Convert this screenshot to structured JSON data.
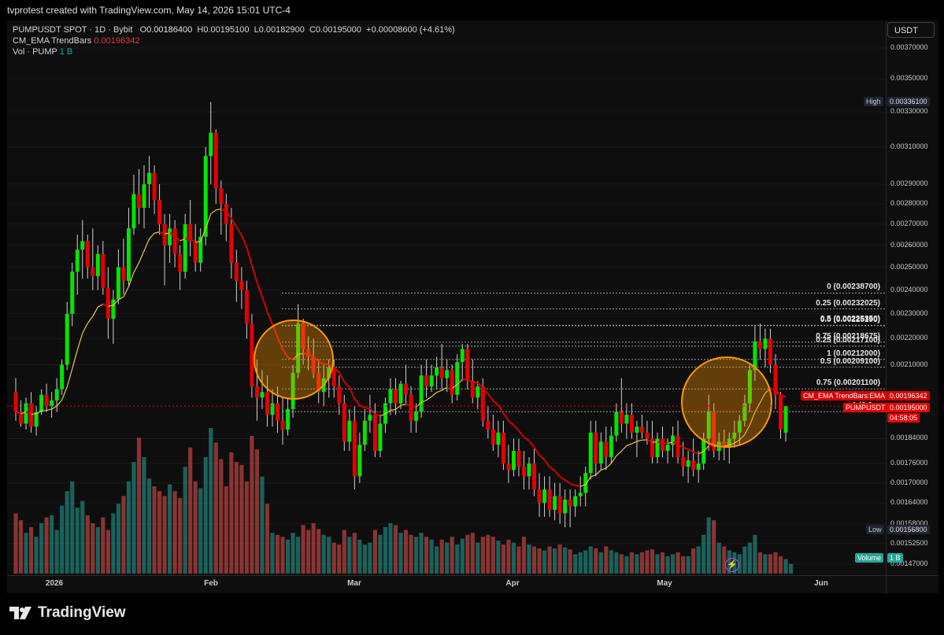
{
  "header": {
    "title": "tvprotest created with TradingView.com, May 14, 2026 15:01 UTC-4"
  },
  "legend": {
    "symbol": "PUMPUSDT SPOT · 1D · Bybit",
    "ohlc": {
      "o_label": "O",
      "o": "0.00186400",
      "h_label": "H",
      "h": "0.00195100",
      "l_label": "L",
      "l": "0.00182900",
      "c_label": "C",
      "c": "0.00195000",
      "change": "+0.00008600 (+4.61%)"
    },
    "indicator_name": "CM_EMA TrendBars",
    "indicator_value": "0.00196342",
    "volume_name": "Vol · PUMP",
    "volume_value": "1 B"
  },
  "currency_button": "USDT",
  "y_axis_ticks": [
    "0.00370000",
    "0.00350000",
    "0.00330000",
    "0.00310000",
    "0.00290000",
    "0.00280000",
    "0.00270000",
    "0.00260000",
    "0.00250000",
    "0.00240000",
    "0.00230000",
    "0.00220000",
    "0.00210000",
    "0.00184000",
    "0.00176000",
    "0.00170000",
    "0.00164000",
    "0.00158000",
    "0.00152500",
    "0.00147000"
  ],
  "x_axis_ticks": [
    "2026",
    "Feb",
    "Mar",
    "Apr",
    "May",
    "Jun"
  ],
  "price_tags": {
    "high_label": "High",
    "high": "0.00336100",
    "ema_label": "CM_EMA TrendBars:EMA",
    "ema": "0.00196342",
    "last_label": "PUMPUSDT",
    "last": "0.00195000",
    "countdown": "04:58:05",
    "low_label": "Low",
    "low": "0.00156800",
    "volume_label": "Volume",
    "volume": "1 B"
  },
  "fib_levels": [
    {
      "label": "0 (0.00238700)",
      "price": 0.002387
    },
    {
      "label": "0.25 (0.00232025)",
      "price": 0.00232025
    },
    {
      "label": "0.5 (0.00225350)",
      "price": 0.0022535
    },
    {
      "label": "0.0 (0.00225190)",
      "price": 0.0022519
    },
    {
      "label": "0.75 (0.00218675)",
      "price": 0.00218675
    },
    {
      "label": "0.25 (0.00217100)",
      "price": 0.002171
    },
    {
      "label": "1 (0.00212000)",
      "price": 0.00212
    },
    {
      "label": "0.5 (0.00209100)",
      "price": 0.002091
    },
    {
      "label": "0.75 (0.00201100)",
      "price": 0.002011
    },
    {
      "label": "1 (0.0…",
      "price": 0.001931
    }
  ],
  "colors": {
    "up": "#00e600",
    "down": "#e60000",
    "ema": "#d50000",
    "ema_up": "#e6c84a",
    "vol_up": "#26a69a",
    "vol_down": "#ef5350",
    "circle": "#ff9800",
    "background": "#0e0e0e"
  },
  "brand": "TradingView",
  "chart_data": {
    "type": "candlestick",
    "title": "PUMPUSDT SPOT · 1D · Bybit",
    "ylim": [
      0.00147,
      0.0038
    ],
    "y_scale": "log",
    "x_start": "2025-12-23",
    "x_end": "2026-06-08",
    "candles": [
      [
        0.002,
        0.00205,
        0.0019,
        0.00193
      ],
      [
        0.00193,
        0.00197,
        0.00188,
        0.00189
      ],
      [
        0.00189,
        0.00198,
        0.00187,
        0.00196
      ],
      [
        0.00196,
        0.002,
        0.00186,
        0.00188
      ],
      [
        0.00188,
        0.00195,
        0.00185,
        0.00193
      ],
      [
        0.00193,
        0.00201,
        0.00192,
        0.00199
      ],
      [
        0.00199,
        0.00203,
        0.00193,
        0.00195
      ],
      [
        0.00195,
        0.002,
        0.00191,
        0.00197
      ],
      [
        0.00197,
        0.00205,
        0.00193,
        0.00201
      ],
      [
        0.00201,
        0.00212,
        0.00199,
        0.0021
      ],
      [
        0.0021,
        0.00235,
        0.00208,
        0.0023
      ],
      [
        0.0023,
        0.00252,
        0.00225,
        0.00248
      ],
      [
        0.00248,
        0.00265,
        0.00238,
        0.00258
      ],
      [
        0.00258,
        0.00272,
        0.00245,
        0.00262
      ],
      [
        0.00262,
        0.00265,
        0.00245,
        0.0025
      ],
      [
        0.0025,
        0.00268,
        0.0024,
        0.00246
      ],
      [
        0.00246,
        0.0026,
        0.0024,
        0.00256
      ],
      [
        0.00256,
        0.00262,
        0.00238,
        0.00241
      ],
      [
        0.00241,
        0.0025,
        0.0022,
        0.00228
      ],
      [
        0.00228,
        0.0024,
        0.00218,
        0.00236
      ],
      [
        0.00236,
        0.00258,
        0.00234,
        0.0025
      ],
      [
        0.0025,
        0.00263,
        0.00238,
        0.00244
      ],
      [
        0.00244,
        0.00278,
        0.00242,
        0.00268
      ],
      [
        0.00268,
        0.00295,
        0.00265,
        0.00285
      ],
      [
        0.00285,
        0.00298,
        0.0027,
        0.00278
      ],
      [
        0.00278,
        0.003,
        0.00268,
        0.0029
      ],
      [
        0.0029,
        0.00305,
        0.00278,
        0.00296
      ],
      [
        0.00296,
        0.003,
        0.00275,
        0.00282
      ],
      [
        0.00282,
        0.0029,
        0.00265,
        0.0027
      ],
      [
        0.0027,
        0.00275,
        0.00242,
        0.0026
      ],
      [
        0.0026,
        0.00275,
        0.00252,
        0.00268
      ],
      [
        0.00268,
        0.00272,
        0.0025,
        0.00256
      ],
      [
        0.00256,
        0.0026,
        0.0024,
        0.00248
      ],
      [
        0.00248,
        0.00275,
        0.00245,
        0.0027
      ],
      [
        0.0027,
        0.00282,
        0.00255,
        0.00262
      ],
      [
        0.00262,
        0.0027,
        0.00248,
        0.00252
      ],
      [
        0.00252,
        0.00268,
        0.00248,
        0.00264
      ],
      [
        0.00264,
        0.0031,
        0.0026,
        0.00305
      ],
      [
        0.00305,
        0.00336,
        0.0029,
        0.00318
      ],
      [
        0.00318,
        0.0032,
        0.0028,
        0.00288
      ],
      [
        0.00288,
        0.00292,
        0.00265,
        0.0028
      ],
      [
        0.0028,
        0.00285,
        0.00262,
        0.0027
      ],
      [
        0.0027,
        0.00278,
        0.00245,
        0.00252
      ],
      [
        0.00252,
        0.00258,
        0.00235,
        0.00244
      ],
      [
        0.00244,
        0.0025,
        0.00232,
        0.0024
      ],
      [
        0.0024,
        0.00244,
        0.0022,
        0.00226
      ],
      [
        0.00226,
        0.0023,
        0.00198,
        0.00202
      ],
      [
        0.00202,
        0.00212,
        0.0019,
        0.00198
      ],
      [
        0.00198,
        0.00208,
        0.00194,
        0.002
      ],
      [
        0.002,
        0.00206,
        0.00188,
        0.00192
      ],
      [
        0.00192,
        0.00201,
        0.00188,
        0.00196
      ],
      [
        0.00196,
        0.00202,
        0.00186,
        0.0019
      ],
      [
        0.0019,
        0.00198,
        0.00182,
        0.00187
      ],
      [
        0.00187,
        0.00198,
        0.00185,
        0.00194
      ],
      [
        0.00194,
        0.0021,
        0.00191,
        0.00207
      ],
      [
        0.00207,
        0.00234,
        0.00205,
        0.00226
      ],
      [
        0.00226,
        0.00228,
        0.0021,
        0.00216
      ],
      [
        0.00216,
        0.00221,
        0.00208,
        0.00213
      ],
      [
        0.00213,
        0.0022,
        0.00205,
        0.00207
      ],
      [
        0.00207,
        0.00212,
        0.00196,
        0.002
      ],
      [
        0.002,
        0.0021,
        0.00195,
        0.00205
      ],
      [
        0.00205,
        0.00212,
        0.00198,
        0.00209
      ],
      [
        0.00209,
        0.00212,
        0.00198,
        0.00202
      ],
      [
        0.00202,
        0.00206,
        0.00192,
        0.00196
      ],
      [
        0.00196,
        0.00199,
        0.0018,
        0.00183
      ],
      [
        0.00183,
        0.00194,
        0.0018,
        0.0019
      ],
      [
        0.0019,
        0.00195,
        0.00168,
        0.00172
      ],
      [
        0.00172,
        0.00186,
        0.0017,
        0.00182
      ],
      [
        0.00182,
        0.00194,
        0.0018,
        0.0019
      ],
      [
        0.0019,
        0.00199,
        0.00186,
        0.00192
      ],
      [
        0.00192,
        0.00196,
        0.00178,
        0.0018
      ],
      [
        0.0018,
        0.00192,
        0.00178,
        0.00189
      ],
      [
        0.00189,
        0.00198,
        0.00186,
        0.00196
      ],
      [
        0.00196,
        0.00205,
        0.00192,
        0.00201
      ],
      [
        0.00201,
        0.00205,
        0.00192,
        0.00196
      ],
      [
        0.00196,
        0.00204,
        0.00194,
        0.00203
      ],
      [
        0.00203,
        0.0021,
        0.00196,
        0.00199
      ],
      [
        0.00199,
        0.00202,
        0.00186,
        0.0019
      ],
      [
        0.0019,
        0.00196,
        0.00186,
        0.00193
      ],
      [
        0.00193,
        0.0021,
        0.00191,
        0.00206
      ],
      [
        0.00206,
        0.00212,
        0.00198,
        0.00202
      ],
      [
        0.00202,
        0.0021,
        0.002,
        0.00206
      ],
      [
        0.00206,
        0.00213,
        0.00201,
        0.00209
      ],
      [
        0.00209,
        0.00218,
        0.00201,
        0.00205
      ],
      [
        0.00205,
        0.00212,
        0.002,
        0.00208
      ],
      [
        0.00208,
        0.0021,
        0.00196,
        0.00199
      ],
      [
        0.00199,
        0.00214,
        0.00197,
        0.00211
      ],
      [
        0.00211,
        0.00218,
        0.00204,
        0.00216
      ],
      [
        0.00216,
        0.00218,
        0.00201,
        0.00204
      ],
      [
        0.00204,
        0.00212,
        0.00196,
        0.00198
      ],
      [
        0.00198,
        0.00204,
        0.00194,
        0.00202
      ],
      [
        0.00202,
        0.00205,
        0.00188,
        0.0019
      ],
      [
        0.0019,
        0.00195,
        0.00184,
        0.00187
      ],
      [
        0.00187,
        0.00192,
        0.0018,
        0.00182
      ],
      [
        0.00182,
        0.0019,
        0.00178,
        0.00186
      ],
      [
        0.00186,
        0.0019,
        0.00174,
        0.00176
      ],
      [
        0.00176,
        0.00182,
        0.0017,
        0.00174
      ],
      [
        0.00174,
        0.00184,
        0.00172,
        0.0018
      ],
      [
        0.0018,
        0.00184,
        0.00172,
        0.00175
      ],
      [
        0.00175,
        0.0018,
        0.00168,
        0.00172
      ],
      [
        0.00172,
        0.00178,
        0.00168,
        0.00176
      ],
      [
        0.00176,
        0.00181,
        0.00166,
        0.00168
      ],
      [
        0.00168,
        0.00173,
        0.0016,
        0.00164
      ],
      [
        0.00164,
        0.00172,
        0.0016,
        0.00168
      ],
      [
        0.00168,
        0.00172,
        0.0016,
        0.00162
      ],
      [
        0.00162,
        0.0017,
        0.00159,
        0.00166
      ],
      [
        0.00166,
        0.0017,
        0.00158,
        0.00161
      ],
      [
        0.00161,
        0.00168,
        0.00157,
        0.00165
      ],
      [
        0.00165,
        0.00168,
        0.00157,
        0.00163
      ],
      [
        0.00163,
        0.00168,
        0.0016,
        0.00166
      ],
      [
        0.00166,
        0.00172,
        0.00163,
        0.00167
      ],
      [
        0.00167,
        0.00175,
        0.00163,
        0.00173
      ],
      [
        0.00173,
        0.0019,
        0.00171,
        0.00186
      ],
      [
        0.00186,
        0.0019,
        0.00172,
        0.00176
      ],
      [
        0.00176,
        0.00186,
        0.00174,
        0.00183
      ],
      [
        0.00183,
        0.00188,
        0.00174,
        0.00178
      ],
      [
        0.00178,
        0.00188,
        0.00176,
        0.00185
      ],
      [
        0.00185,
        0.00196,
        0.00183,
        0.00193
      ],
      [
        0.00193,
        0.00205,
        0.00186,
        0.00189
      ],
      [
        0.00189,
        0.00196,
        0.00184,
        0.00192
      ],
      [
        0.00192,
        0.00196,
        0.00184,
        0.00186
      ],
      [
        0.00186,
        0.0019,
        0.00178,
        0.00188
      ],
      [
        0.00188,
        0.00192,
        0.00184,
        0.00186
      ],
      [
        0.00186,
        0.0019,
        0.00182,
        0.00184
      ],
      [
        0.00184,
        0.0019,
        0.00176,
        0.00178
      ],
      [
        0.00178,
        0.00186,
        0.00176,
        0.00184
      ],
      [
        0.00184,
        0.00188,
        0.00178,
        0.0018
      ],
      [
        0.0018,
        0.00184,
        0.00176,
        0.00182
      ],
      [
        0.00182,
        0.00188,
        0.00178,
        0.00185
      ],
      [
        0.00185,
        0.0019,
        0.00176,
        0.00178
      ],
      [
        0.00178,
        0.00183,
        0.00172,
        0.00175
      ],
      [
        0.00175,
        0.0018,
        0.0017,
        0.00177
      ],
      [
        0.00177,
        0.00184,
        0.00172,
        0.00174
      ],
      [
        0.00174,
        0.0018,
        0.0017,
        0.00176
      ],
      [
        0.00176,
        0.00186,
        0.00174,
        0.00184
      ],
      [
        0.00184,
        0.00199,
        0.0018,
        0.00193
      ],
      [
        0.00193,
        0.00196,
        0.00178,
        0.0018
      ],
      [
        0.0018,
        0.00186,
        0.00177,
        0.00183
      ],
      [
        0.00183,
        0.00187,
        0.00177,
        0.00181
      ],
      [
        0.00181,
        0.00186,
        0.00176,
        0.00184
      ],
      [
        0.00184,
        0.0019,
        0.00181,
        0.00186
      ],
      [
        0.00186,
        0.00192,
        0.00182,
        0.0019
      ],
      [
        0.0019,
        0.00199,
        0.00188,
        0.00196
      ],
      [
        0.00196,
        0.0021,
        0.00193,
        0.00208
      ],
      [
        0.00208,
        0.00225,
        0.00204,
        0.00219
      ],
      [
        0.00219,
        0.00226,
        0.00212,
        0.00216
      ],
      [
        0.00216,
        0.00224,
        0.00209,
        0.0022
      ],
      [
        0.0022,
        0.00224,
        0.00207,
        0.0021
      ],
      [
        0.0021,
        0.00214,
        0.00194,
        0.00199
      ],
      [
        0.00199,
        0.002,
        0.00184,
        0.00187
      ],
      [
        0.00186,
        0.00195,
        0.00183,
        0.00195
      ]
    ],
    "volume": [
      62,
      55,
      42,
      48,
      38,
      52,
      58,
      60,
      45,
      70,
      85,
      95,
      68,
      75,
      60,
      52,
      48,
      58,
      45,
      62,
      72,
      80,
      95,
      115,
      140,
      120,
      98,
      90,
      85,
      80,
      92,
      85,
      78,
      110,
      130,
      95,
      88,
      120,
      150,
      135,
      118,
      90,
      125,
      115,
      112,
      95,
      142,
      128,
      100,
      72,
      42,
      40,
      38,
      35,
      42,
      38,
      50,
      45,
      52,
      46,
      40,
      38,
      32,
      30,
      45,
      38,
      42,
      35,
      30,
      32,
      45,
      40,
      48,
      52,
      50,
      42,
      45,
      40,
      38,
      42,
      38,
      35,
      28,
      35,
      32,
      38,
      30,
      36,
      40,
      42,
      32,
      38,
      40,
      38,
      34,
      30,
      35,
      32,
      28,
      38,
      30,
      28,
      26,
      24,
      28,
      26,
      30,
      27,
      25,
      20,
      22,
      24,
      28,
      26,
      22,
      28,
      24,
      22,
      20,
      18,
      22,
      20,
      22,
      24,
      25,
      20,
      22,
      18,
      20,
      22,
      18,
      18,
      26,
      28,
      40,
      58,
      55,
      32,
      28,
      24,
      22,
      20,
      28,
      32,
      40,
      22,
      20,
      20,
      22,
      18,
      15,
      10
    ],
    "ema_period": 13
  }
}
